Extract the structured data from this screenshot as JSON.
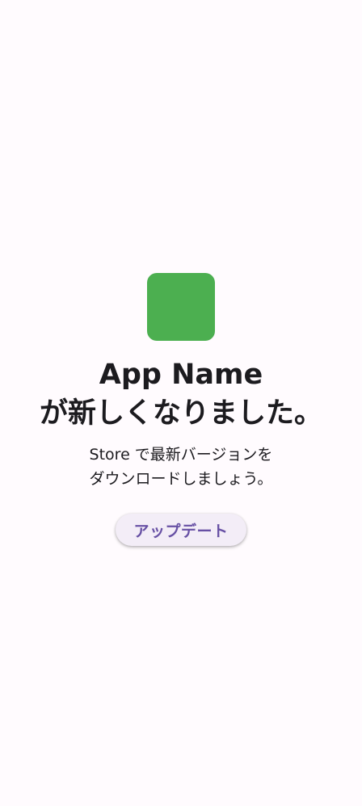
{
  "app": {
    "icon_color": "#4caf50",
    "name": "App Name",
    "headline": "が新しくなりました。"
  },
  "message": {
    "line1": "Store で最新バージョンを",
    "line2": "ダウンロードしましょう。"
  },
  "actions": {
    "update_label": "アップデート"
  },
  "colors": {
    "background": "#fffbfe",
    "text": "#1c1b1f",
    "button_bg": "#f3edf7",
    "button_text": "#6750a4"
  }
}
